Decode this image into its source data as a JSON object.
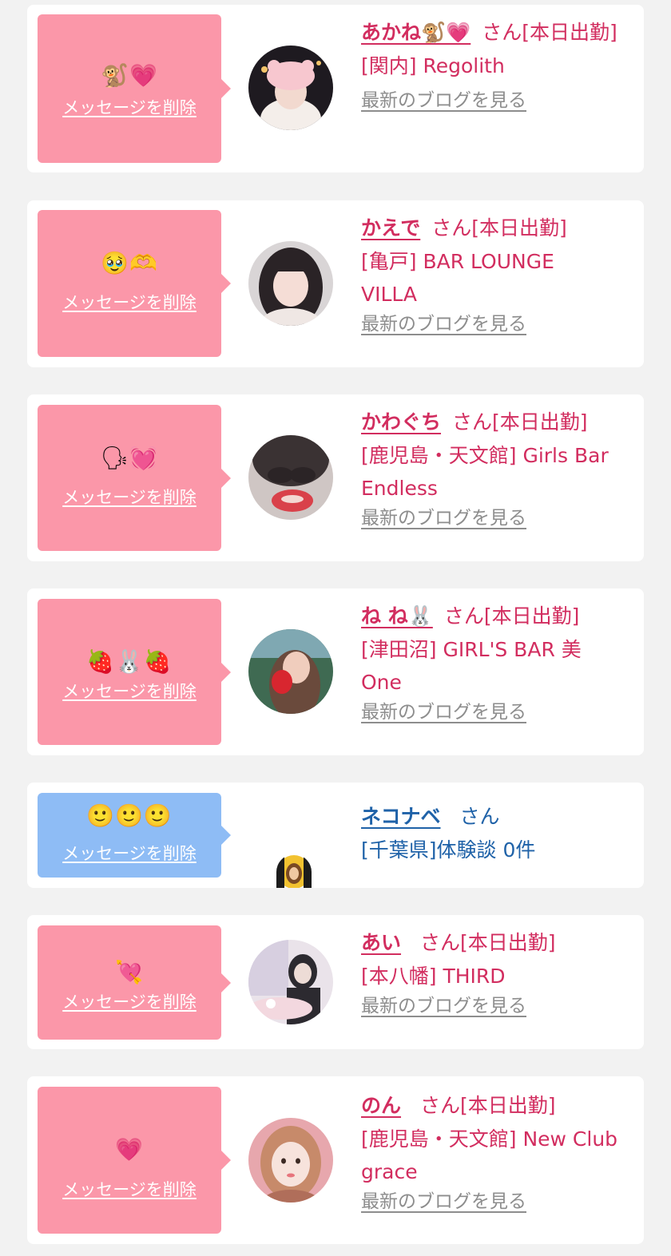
{
  "delete_label": "メッセージを削除",
  "blog_label": "最新のブログを見る",
  "honorific": "さん",
  "entries": [
    {
      "emoji": "🐒💗",
      "name": "あかね🐒💗",
      "status": "[本日出勤]",
      "shop_line1": "[関内] Regolith",
      "shop_line2": "",
      "color": "pink",
      "avatar_icon": "girl-white-hat-photo"
    },
    {
      "emoji": "🥹🫶",
      "name": "かえで",
      "status": "[本日出勤]",
      "shop_line1": "[亀戸] BAR LOUNGE",
      "shop_line2": "VILLA",
      "color": "pink",
      "avatar_icon": "girl-dark-hair-photo"
    },
    {
      "emoji": "🗣💓",
      "name": "かわぐち",
      "status": "[本日出勤]",
      "shop_line1": "[鹿児島・天文館] Girls Bar",
      "shop_line2": "Endless",
      "color": "pink",
      "avatar_icon": "distorted-face-photo"
    },
    {
      "emoji": "🍓🐰🍓",
      "name": "ね ね🐰",
      "status": "[本日出勤]",
      "shop_line1": "[津田沼] GIRL'S BAR 美",
      "shop_line2": "One",
      "color": "pink",
      "avatar_icon": "girl-strawberry-photo"
    },
    {
      "emoji": "🙂🙂🙂",
      "name": "ネコナベ",
      "status": "",
      "shop_line1": "[千葉県]体験談 0件",
      "shop_line2": "",
      "color": "blue",
      "avatar_icon": "small-avatar"
    },
    {
      "emoji": "💘",
      "name": "あい",
      "status": "[本日出勤]",
      "shop_line1": "[本八幡] THIRD",
      "shop_line2": "",
      "color": "pink",
      "avatar_icon": "cafe-photo"
    },
    {
      "emoji": "💗",
      "name": "のん",
      "status": "[本日出勤]",
      "shop_line1": "[鹿児島・天文館] New Club",
      "shop_line2": "grace",
      "color": "pink",
      "avatar_icon": "girl-portrait-photo"
    }
  ]
}
